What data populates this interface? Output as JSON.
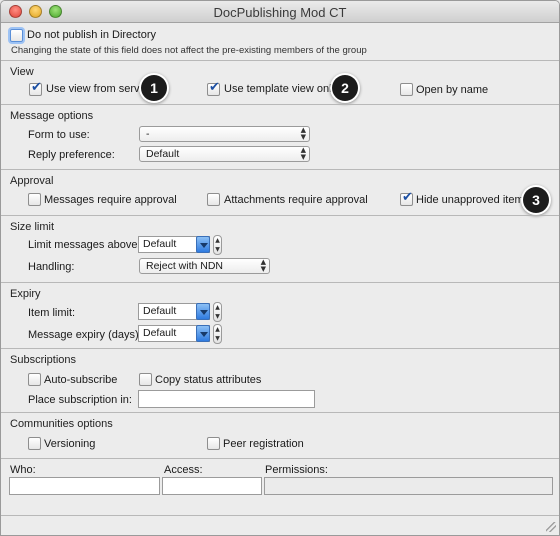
{
  "window": {
    "title": "DocPublishing Mod CT"
  },
  "directory": {
    "no_publish_label": "Do not publish in Directory",
    "no_publish_checked": false,
    "note": "Changing the state of this field does not affect the pre-existing members of the group"
  },
  "view": {
    "title": "View",
    "use_server_label": "Use view from server",
    "use_server_checked": true,
    "template_only_label": "Use template view only",
    "template_only_checked": true,
    "open_by_name_label": "Open by name",
    "open_by_name_checked": false
  },
  "message_options": {
    "title": "Message options",
    "form_label": "Form to use:",
    "form_value": "-",
    "reply_label": "Reply preference:",
    "reply_value": "Default"
  },
  "approval": {
    "title": "Approval",
    "messages_label": "Messages require approval",
    "messages_checked": false,
    "attachments_label": "Attachments require approval",
    "attachments_checked": false,
    "hide_label": "Hide unapproved items",
    "hide_checked": true
  },
  "size_limit": {
    "title": "Size limit",
    "limit_label": "Limit messages above:",
    "limit_value": "Default",
    "handling_label": "Handling:",
    "handling_value": "Reject with NDN"
  },
  "expiry": {
    "title": "Expiry",
    "item_label": "Item limit:",
    "item_value": "Default",
    "message_label": "Message expiry (days):",
    "message_value": "Default"
  },
  "subscriptions": {
    "title": "Subscriptions",
    "auto_label": "Auto-subscribe",
    "auto_checked": false,
    "copy_label": "Copy status attributes",
    "copy_checked": false,
    "place_label": "Place subscription in:",
    "place_value": ""
  },
  "communities": {
    "title": "Communities options",
    "versioning_label": "Versioning",
    "versioning_checked": false,
    "peer_label": "Peer registration",
    "peer_checked": false
  },
  "acl": {
    "who_label": "Who:",
    "access_label": "Access:",
    "permissions_label": "Permissions:",
    "who_value": "",
    "access_value": "",
    "permissions_value": ""
  },
  "markers": [
    "1",
    "2",
    "3"
  ]
}
